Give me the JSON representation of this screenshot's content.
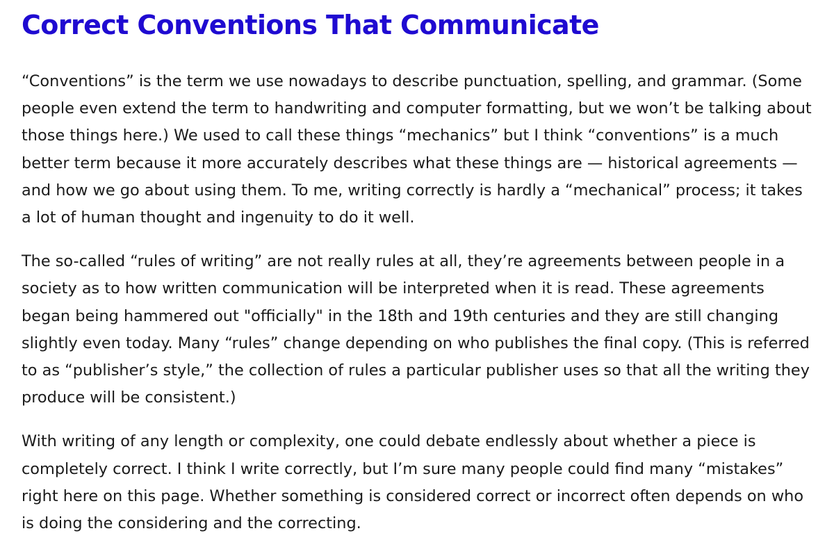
{
  "article": {
    "title": "Correct Conventions That Communicate",
    "paragraphs": [
      "“Conventions” is the term we use nowadays to describe punctuation, spelling, and grammar. (Some people even extend the term to handwriting and computer formatting, but we won’t be talking about those things here.) We used to call these things “mechanics” but I think “conventions” is a much better term because it more accurately describes what these things are — historical agreements — and how we go about using them. To me, writing correctly is hardly a “mechanical” process; it takes a lot of human thought and ingenuity to do it well.",
      "The so-called “rules of writing” are not really rules at all, they’re agreements between people in a society as to how written communication will be interpreted when it is read. These agreements began being hammered out \"officially\" in the 18th and 19th centuries and they are still changing slightly even today. Many “rules” change depending on who publishes the final copy. (This is referred to as “publisher’s style,” the collection of rules a particular publisher uses so that all the writing they produce will be consistent.)",
      "With writing of any length or complexity, one could debate endlessly about whether a piece is completely correct. I think I write correctly, but I’m sure many people could find many “mistakes” right here on this page. Whether something is considered correct or incorrect often depends on who is doing the considering and the correcting."
    ]
  },
  "colors": {
    "title": "#1f0ad1",
    "text": "#1b1b1b",
    "background": "#ffffff"
  }
}
